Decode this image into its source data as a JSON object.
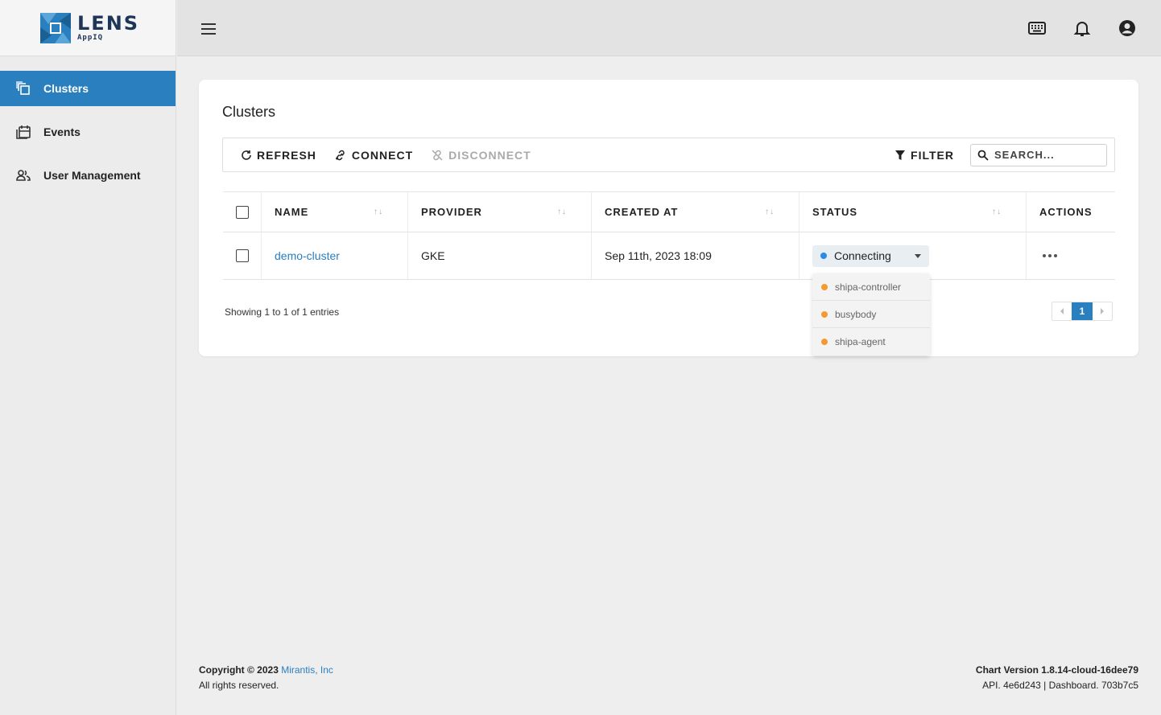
{
  "app": {
    "logo_title": "LENS",
    "logo_sub": "AppIQ"
  },
  "sidebar": {
    "items": [
      {
        "label": "Clusters",
        "icon": "clusters-icon",
        "active": true
      },
      {
        "label": "Events",
        "icon": "calendar-icon",
        "active": false
      },
      {
        "label": "User Management",
        "icon": "users-icon",
        "active": false
      }
    ]
  },
  "header": {
    "icons": [
      "keyboard-icon",
      "bell-icon",
      "account-icon"
    ]
  },
  "page": {
    "title": "Clusters"
  },
  "toolbar": {
    "refresh_label": "REFRESH",
    "connect_label": "CONNECT",
    "disconnect_label": "DISCONNECT",
    "filter_label": "FILTER",
    "search_placeholder": "SEARCH..."
  },
  "table": {
    "columns": {
      "name": "NAME",
      "provider": "PROVIDER",
      "created_at": "CREATED AT",
      "status": "STATUS",
      "actions": "ACTIONS"
    },
    "rows": [
      {
        "name": "demo-cluster",
        "provider": "GKE",
        "created_at": "Sep 11th, 2023 18:09",
        "status": "Connecting",
        "status_color": "#2a8be8"
      }
    ]
  },
  "status_dropdown": {
    "items": [
      {
        "label": "shipa-controller",
        "color": "#f29b2e"
      },
      {
        "label": "busybody",
        "color": "#f29b2e"
      },
      {
        "label": "shipa-agent",
        "color": "#f29b2e"
      }
    ]
  },
  "pagination": {
    "showing": "Showing 1 to 1 of 1 entries",
    "current_page": "1"
  },
  "footer": {
    "copyright": "Copyright © 2023 ",
    "company": "Mirantis, Inc",
    "rights": "All rights reserved.",
    "chart_version": "Chart Version 1.8.14-cloud-16dee79",
    "api_info": "API. 4e6d243 | Dashboard. 703b7c5"
  },
  "colors": {
    "accent": "#2a7fbf"
  }
}
